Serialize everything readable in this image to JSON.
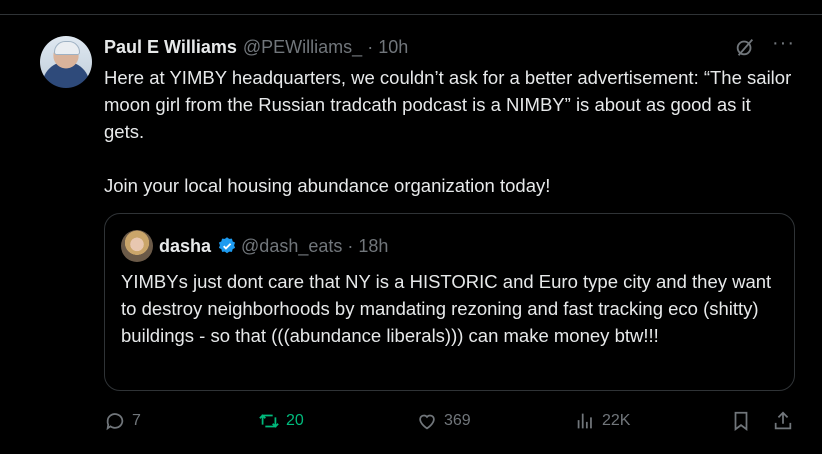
{
  "post": {
    "author_name": "Paul E Williams",
    "author_handle": "@PEWilliams_",
    "separator": "·",
    "time": "10h",
    "text": "Here at YIMBY headquarters, we couldn’t ask for a better advertisement: “The sailor moon girl from the Russian tradcath podcast is a NIMBY” is about as good as it gets.\n\nJoin your local housing abundance organization today!",
    "more_label": "···"
  },
  "quote": {
    "author_name": "dasha",
    "author_handle": "@dash_eats",
    "separator": "·",
    "time": "18h",
    "text": "YIMBYs just dont care that NY is a HISTORIC and Euro type city and they want to destroy neighborhoods by mandating rezoning and fast tracking eco (shitty) buildings - so that (((abundance liberals))) can make money btw!!!"
  },
  "actions": {
    "replies": "7",
    "reposts": "20",
    "likes": "369",
    "views": "22K"
  },
  "colors": {
    "repost_active": "#00ba7c",
    "verified": "#1d9bf0",
    "muted": "#71767b"
  },
  "icons": [
    "grok-icon",
    "more-icon",
    "verified-badge-icon",
    "reply-icon",
    "repost-icon",
    "like-icon",
    "views-icon",
    "bookmark-icon",
    "share-icon"
  ]
}
